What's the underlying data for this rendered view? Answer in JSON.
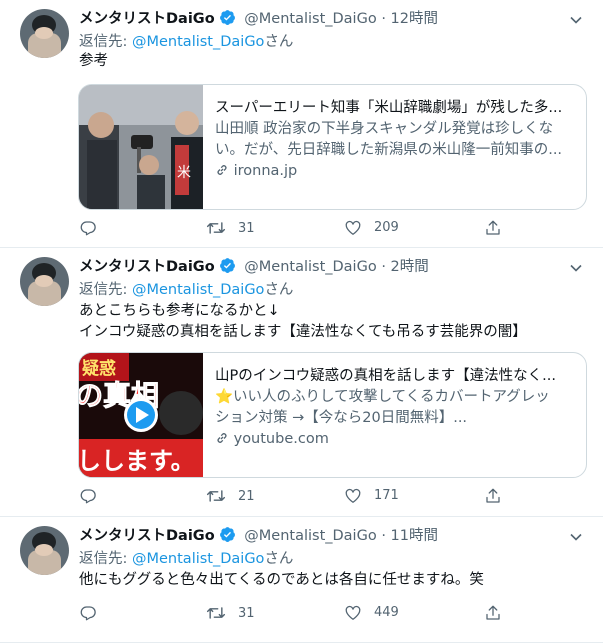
{
  "tweets": [
    {
      "name": "メンタリストDaiGo",
      "handle": "@Mentalist_DaiGo",
      "dot": "·",
      "time": "12時間",
      "reply_prefix": "返信先: ",
      "reply_mention": "@Mentalist_DaiGo",
      "reply_suffix": "さん",
      "lines": [
        "参考"
      ],
      "card": {
        "title": "スーパーエリート知事「米山辞職劇場」が残した多...",
        "desc_lines": [
          "山田順 政治家の下半身スキャンダル発覚は珍しくな",
          "い。だが、先日辞職した新潟県の米山隆一前知事の..."
        ],
        "domain": "ironna.jp",
        "image": "news-photo",
        "image_text": "米"
      },
      "replies": "",
      "retweets": "31",
      "likes": "209"
    },
    {
      "name": "メンタリストDaiGo",
      "handle": "@Mentalist_DaiGo",
      "dot": "·",
      "time": "2時間",
      "reply_prefix": "返信先: ",
      "reply_mention": "@Mentalist_DaiGo",
      "reply_suffix": "さん",
      "lines": [
        "あとこちらも参考になるかと↓",
        "インコウ疑惑の真相を話します【違法性なくても吊るす芸能界の闇】"
      ],
      "card": {
        "title": "山Pのインコウ疑惑の真相を話します【違法性なく...",
        "desc_lines": [
          "⭐いい人のふりして攻撃してくるカバートアグレッ",
          "ション対策 →【今なら20日間無料】..."
        ],
        "domain": "youtube.com",
        "image": "video-thumbnail",
        "image_texts": [
          "疑惑",
          "の真相",
          "しします。"
        ]
      },
      "replies": "",
      "retweets": "21",
      "likes": "171"
    },
    {
      "name": "メンタリストDaiGo",
      "handle": "@Mentalist_DaiGo",
      "dot": "·",
      "time": "11時間",
      "reply_prefix": "返信先: ",
      "reply_mention": "@Mentalist_DaiGo",
      "reply_suffix": "さん",
      "lines": [
        "他にもググると色々出てくるのであとは各自に任せますね。笑"
      ],
      "replies": "",
      "retweets": "31",
      "likes": "449"
    }
  ],
  "colors": {
    "accent": "#1b95e0",
    "muted": "#536471",
    "border": "#cfd9de",
    "verified": "#1d9bf0"
  },
  "icons": [
    "verified-badge-icon",
    "chevron-down-icon",
    "reply-icon",
    "retweet-icon",
    "like-icon",
    "share-icon",
    "link-icon",
    "play-icon"
  ]
}
